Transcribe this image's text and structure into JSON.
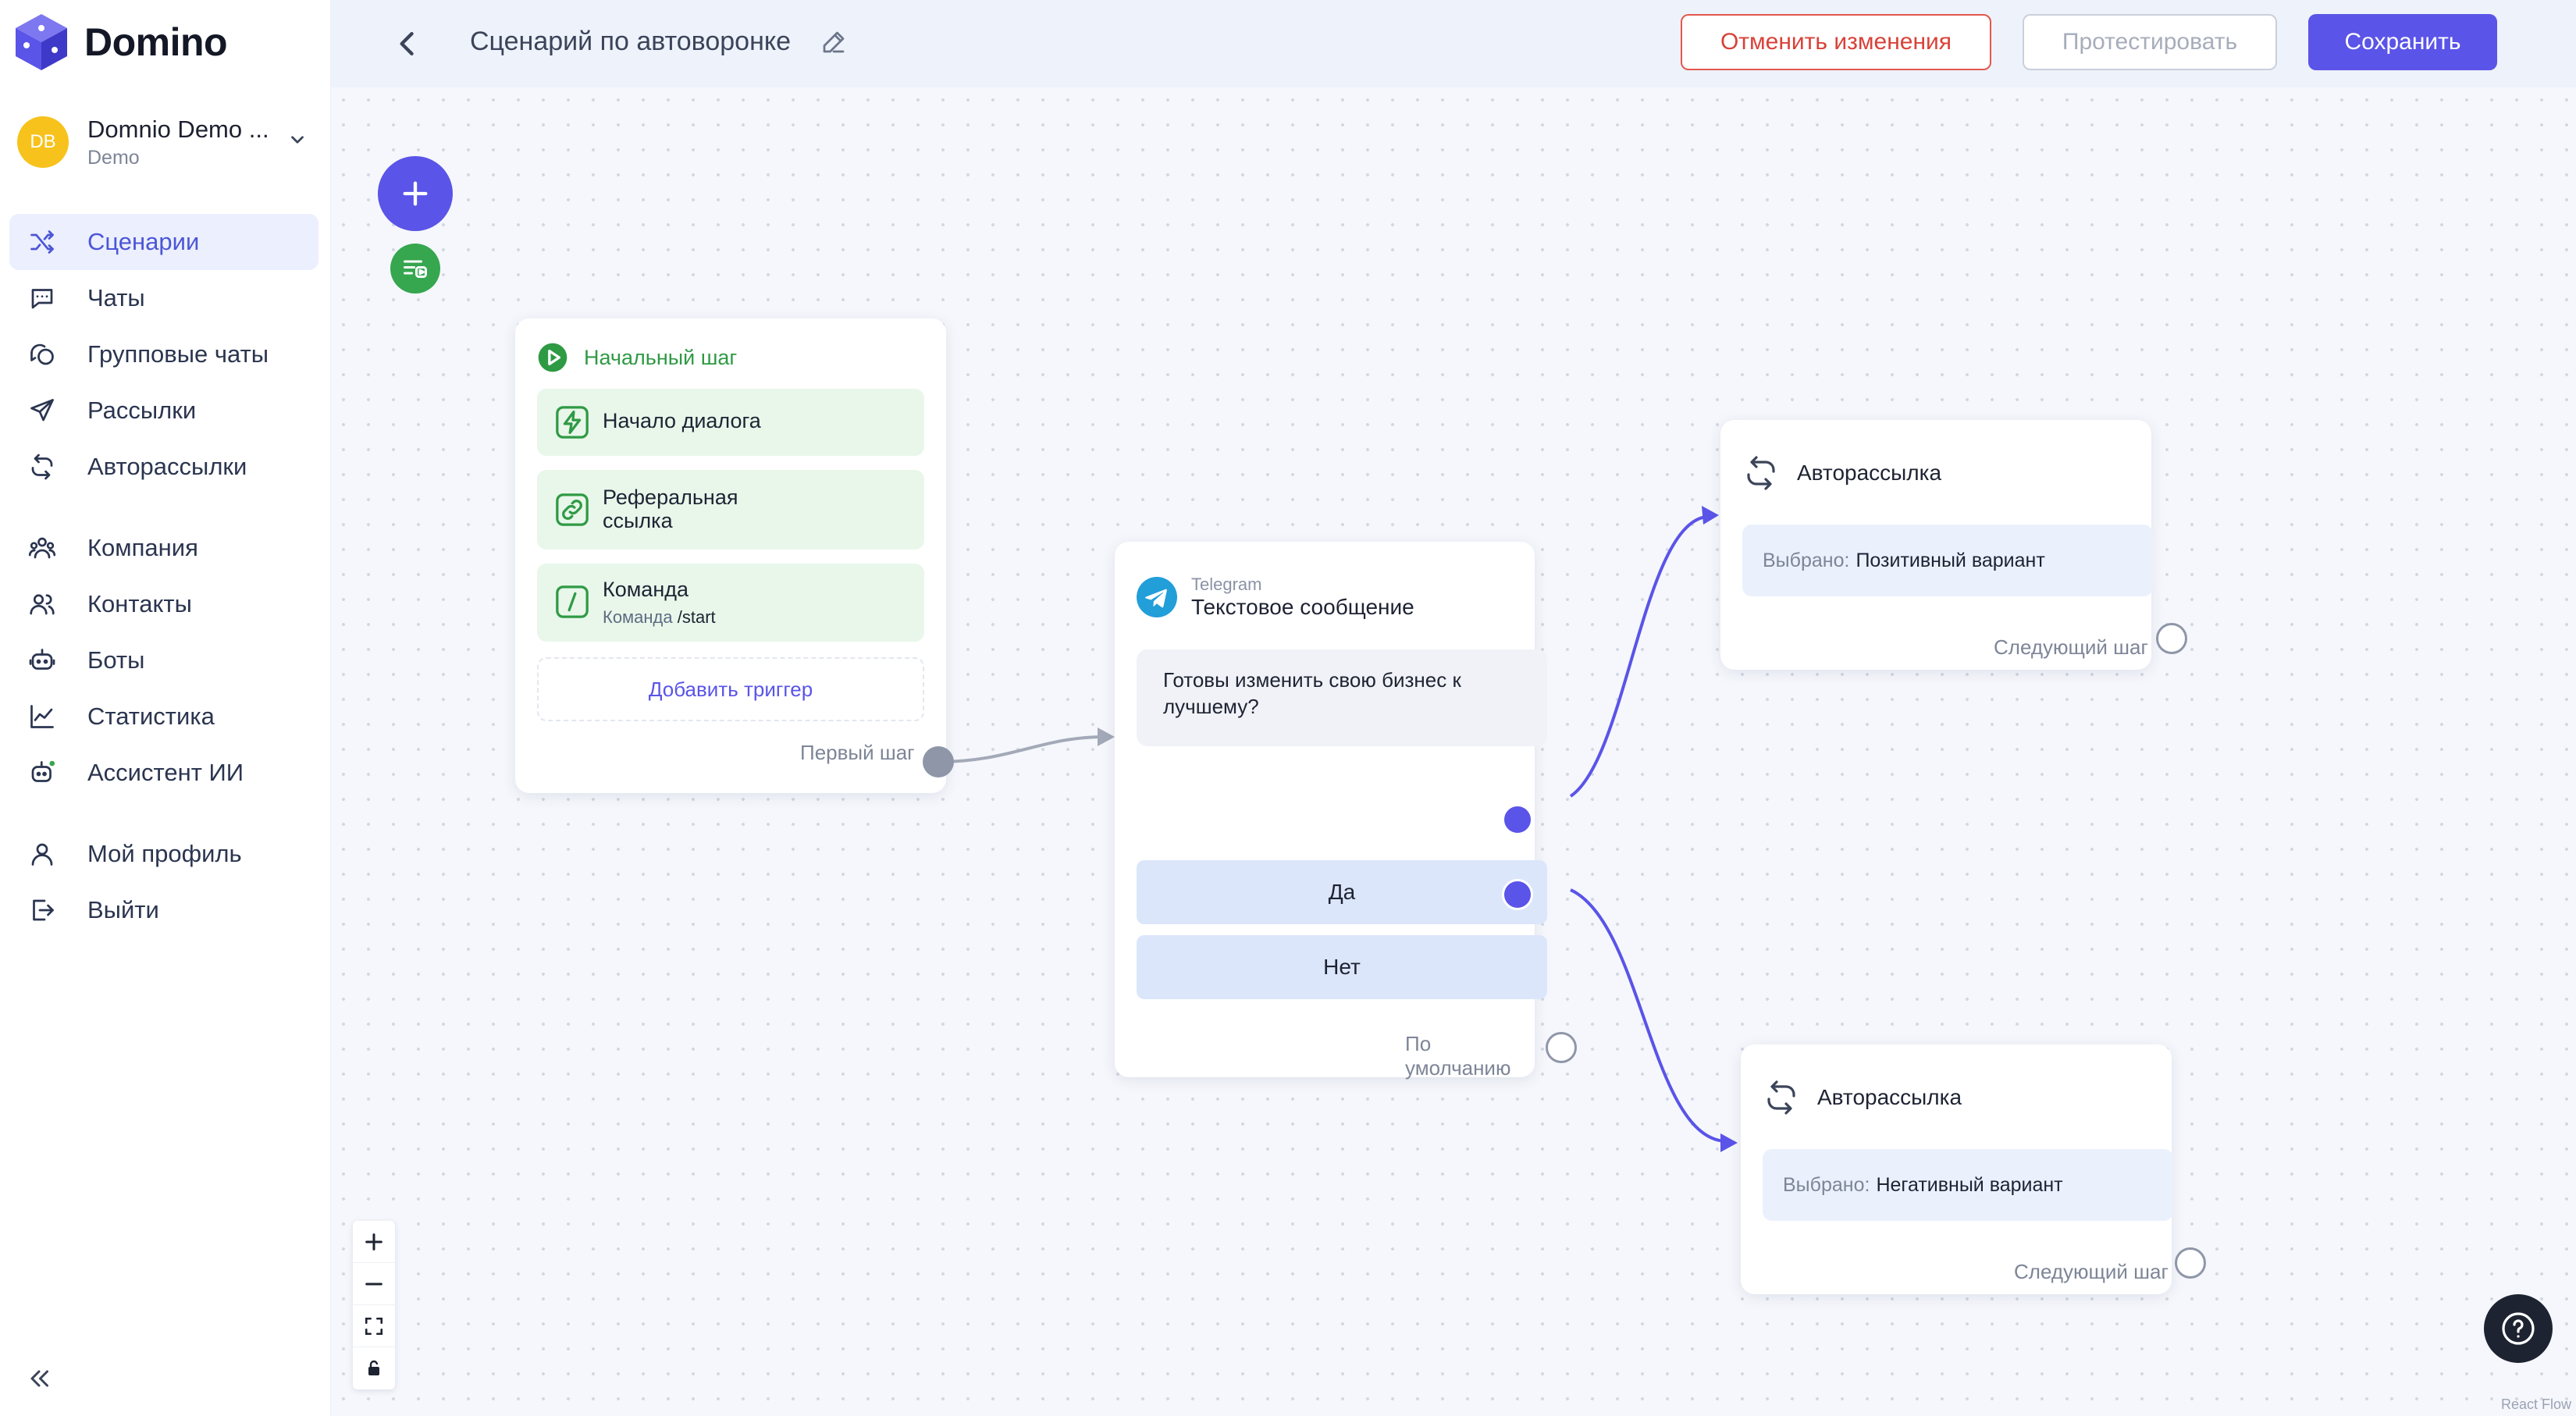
{
  "app": {
    "name": "Domino"
  },
  "account": {
    "initials": "DB",
    "name": "Domnio Demo ...",
    "subtitle": "Demo"
  },
  "sidebar": {
    "items": [
      {
        "label": "Сценарии",
        "icon": "shuffle-icon",
        "active": true
      },
      {
        "label": "Чаты",
        "icon": "chat-icon"
      },
      {
        "label": "Групповые чаты",
        "icon": "group-chat-icon"
      },
      {
        "label": "Рассылки",
        "icon": "send-icon"
      },
      {
        "label": "Авторассылки",
        "icon": "auto-send-icon"
      },
      {
        "label": "Компания",
        "icon": "company-icon"
      },
      {
        "label": "Контакты",
        "icon": "contacts-icon"
      },
      {
        "label": "Боты",
        "icon": "bot-icon"
      },
      {
        "label": "Статистика",
        "icon": "stats-icon"
      },
      {
        "label": "Ассистент ИИ",
        "icon": "ai-assistant-icon"
      },
      {
        "label": "Мой профиль",
        "icon": "profile-icon"
      },
      {
        "label": "Выйти",
        "icon": "logout-icon"
      }
    ]
  },
  "header": {
    "title": "Сценарий по автоворонке",
    "cancel_label": "Отменить изменения",
    "test_label": "Протестировать",
    "save_label": "Сохранить"
  },
  "flow": {
    "start_node": {
      "title": "Начальный шаг",
      "triggers": [
        {
          "label": "Начало диалога",
          "icon": "lightning-icon"
        },
        {
          "label": "Реферальная ссылка",
          "icon": "link-icon"
        },
        {
          "label": "Команда",
          "icon": "slash-icon",
          "sub_label": "Команда",
          "sub_value": "/start"
        }
      ],
      "add_trigger_label": "Добавить триггер",
      "output_label": "Первый шаг"
    },
    "message_node": {
      "channel": "Telegram",
      "type": "Текстовое сообщение",
      "text": "Готовы изменить свою бизнес к лучшему?",
      "buttons": [
        "Да",
        "Нет"
      ],
      "default_label": "По умолчанию"
    },
    "auto_nodes": [
      {
        "title": "Авторассылка",
        "selected_label": "Выбрано:",
        "selected_value": "Позитивный вариант",
        "next_label": "Следующий шаг"
      },
      {
        "title": "Авторассылка",
        "selected_label": "Выбрано:",
        "selected_value": "Негативный вариант",
        "next_label": "Следующий шаг"
      }
    ]
  },
  "attribution": "React Flow",
  "colors": {
    "accent": "#5a54e8",
    "green": "#36a64f",
    "danger": "#e2574c",
    "canvas": "#f5f7fc"
  }
}
